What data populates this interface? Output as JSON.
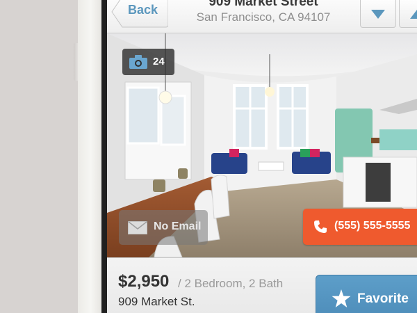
{
  "nav": {
    "back_label": "Back",
    "title": "909 Market Street",
    "subtitle": "San Francisco, CA 94107",
    "down_icon": "chevron-down-icon",
    "up_icon": "chevron-up-icon"
  },
  "photo": {
    "count": "24",
    "count_icon": "camera-icon"
  },
  "actions": {
    "email_label": "No Email",
    "email_icon": "envelope-icon",
    "phone_label": "(555) 555-5555",
    "phone_icon": "phone-icon"
  },
  "listing": {
    "price": "$2,950",
    "details": "/ 2 Bedroom, 2 Bath",
    "address": "909 Market St."
  },
  "favorite": {
    "label": "Favorite",
    "icon": "star-icon"
  },
  "colors": {
    "accent_blue": "#5d9ec9",
    "call_orange": "#ef5a2e",
    "back_text": "#5b97bd"
  }
}
